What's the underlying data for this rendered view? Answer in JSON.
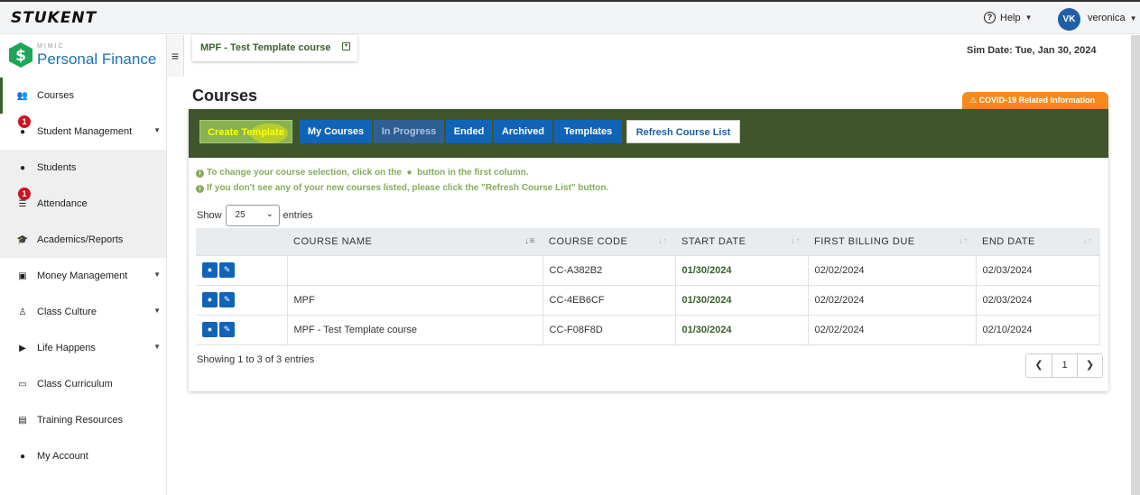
{
  "header": {
    "brand": "STUKENT",
    "help_label": "Help",
    "avatar_initials": "VK",
    "username": "veronica"
  },
  "sidebar": {
    "product_small": "MIMIC",
    "product_name": "Personal Finance",
    "items": [
      {
        "label": "Courses",
        "icon": "users-icon"
      },
      {
        "label": "Student Management",
        "icon": "user-icon",
        "badge": "1",
        "expandable": true
      },
      {
        "label": "Students",
        "icon": "user-icon"
      },
      {
        "label": "Attendance",
        "icon": "list-icon",
        "badge": "1"
      },
      {
        "label": "Academics/Reports",
        "icon": "graduation-cap-icon"
      },
      {
        "label": "Money Management",
        "icon": "money-icon",
        "expandable": true
      },
      {
        "label": "Class Culture",
        "icon": "person-icon",
        "expandable": true
      },
      {
        "label": "Life Happens",
        "icon": "play-icon",
        "expandable": true
      },
      {
        "label": "Class Curriculum",
        "icon": "folder-icon"
      },
      {
        "label": "Training Resources",
        "icon": "file-icon"
      },
      {
        "label": "My Account",
        "icon": "info-icon"
      }
    ]
  },
  "course_selector": {
    "label": "MPF - Test Template course"
  },
  "sim_date": "Sim Date:  Tue, Jan 30, 2024",
  "page_title": "Courses",
  "covid_label": "COVID-19 Related Information",
  "toolbar": {
    "create": "Create Template",
    "my_courses": "My Courses",
    "in_progress": "In Progress",
    "ended": "Ended",
    "archived": "Archived",
    "templates": "Templates",
    "refresh": "Refresh Course List"
  },
  "info": {
    "line1a": "To change your course selection, click on the",
    "line1b": "button in the first column.",
    "line2": "If you don't see any of your new courses listed, please click the \"Refresh Course List\" button."
  },
  "length": {
    "show": "Show",
    "value": "25",
    "entries": "entries"
  },
  "table": {
    "columns": [
      "COURSE NAME",
      "COURSE CODE",
      "START DATE",
      "FIRST BILLING DUE",
      "END DATE"
    ],
    "rows": [
      {
        "name": "",
        "code": "CC-A382B2",
        "start": "01/30/2024",
        "billing": "02/02/2024",
        "end": "02/03/2024"
      },
      {
        "name": "MPF",
        "code": "CC-4EB6CF",
        "start": "01/30/2024",
        "billing": "02/02/2024",
        "end": "02/03/2024"
      },
      {
        "name": "MPF - Test Template course",
        "code": "CC-F08F8D",
        "start": "01/30/2024",
        "billing": "02/02/2024",
        "end": "02/10/2024"
      }
    ]
  },
  "footer": {
    "showing": "Showing 1 to 3 of 3 entries",
    "page": "1"
  },
  "colors": {
    "header_green": "#3f552b",
    "button_blue": "#1064b8",
    "covid_orange": "#f58a1f",
    "brand_blue": "#1a73b5"
  }
}
